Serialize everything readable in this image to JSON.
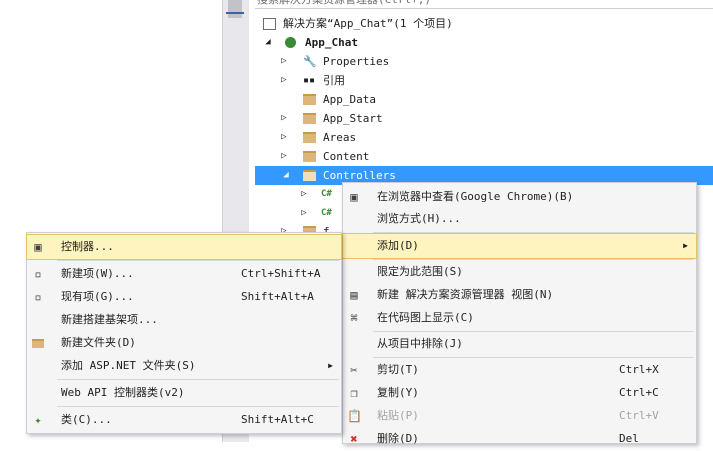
{
  "window": {
    "search_placeholder": "搜索解决方案资源管理器(Ctrl+;)"
  },
  "tree": {
    "solution": "解决方案“App_Chat”(1 个项目)",
    "project": "App_Chat",
    "items": [
      "Properties",
      "引用",
      "App_Data",
      "App_Start",
      "Areas",
      "Content",
      "Controllers"
    ],
    "cs_label": "C#",
    "partial_label": "f"
  },
  "context_menu": {
    "items": [
      {
        "label": "在浏览器中查看(Google Chrome)(B)",
        "shortcut": ""
      },
      {
        "label": "浏览方式(H)...",
        "shortcut": ""
      },
      {
        "label": "添加(D)",
        "shortcut": ""
      },
      {
        "label": "限定为此范围(S)",
        "shortcut": ""
      },
      {
        "label": "新建 解决方案资源管理器 视图(N)",
        "shortcut": ""
      },
      {
        "label": "在代码图上显示(C)",
        "shortcut": ""
      },
      {
        "label": "从项目中排除(J)",
        "shortcut": ""
      },
      {
        "label": "剪切(T)",
        "shortcut": "Ctrl+X"
      },
      {
        "label": "复制(Y)",
        "shortcut": "Ctrl+C"
      },
      {
        "label": "粘贴(P)",
        "shortcut": "Ctrl+V"
      },
      {
        "label": "删除(D)",
        "shortcut": "Del"
      }
    ]
  },
  "add_submenu": {
    "items": [
      {
        "label": "控制器...",
        "shortcut": ""
      },
      {
        "label": "新建项(W)...",
        "shortcut": "Ctrl+Shift+A"
      },
      {
        "label": "现有项(G)...",
        "shortcut": "Shift+Alt+A"
      },
      {
        "label": "新建搭建基架项...",
        "shortcut": ""
      },
      {
        "label": "新建文件夹(D)",
        "shortcut": ""
      },
      {
        "label": "添加 ASP.NET 文件夹(S)",
        "shortcut": ""
      },
      {
        "label": "Web API 控制器类(v2)",
        "shortcut": ""
      },
      {
        "label": "类(C)...",
        "shortcut": "Shift+Alt+C"
      }
    ]
  },
  "colors": {
    "selection": "#3399ff",
    "highlight": "#fdf4bf",
    "folder": "#dcb67a"
  }
}
